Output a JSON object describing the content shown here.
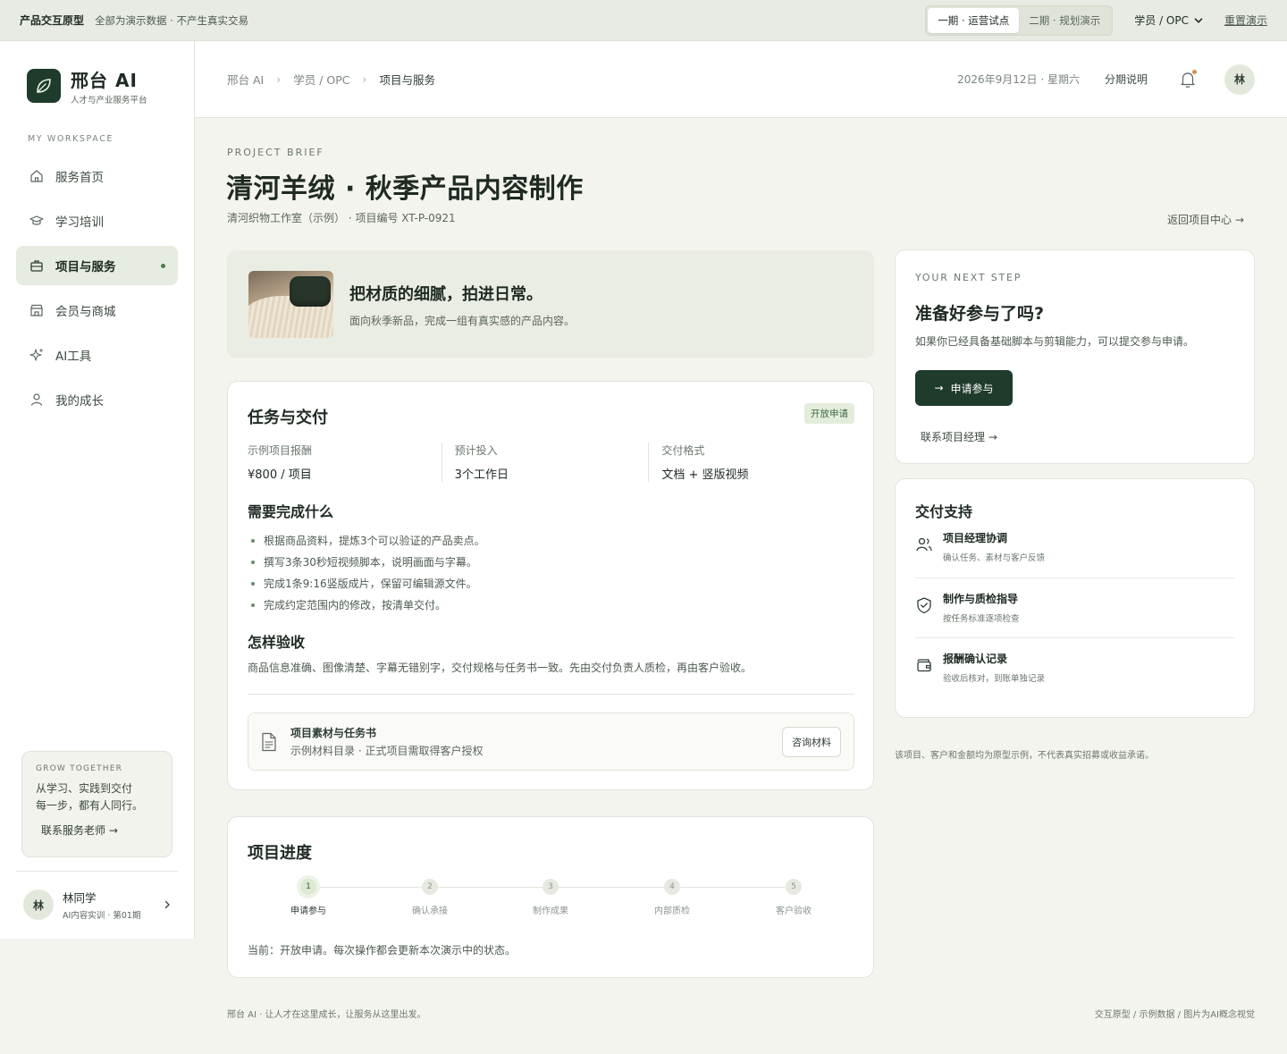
{
  "topbar": {
    "proto_label": "产品交互原型",
    "note": "全部为演示数据 · 不产生真实交易",
    "phases": [
      {
        "label": "一期 · 运营试点",
        "active": true
      },
      {
        "label": "二期 · 规划演示",
        "active": false
      }
    ],
    "role": "学员 / OPC",
    "reset": "重置演示"
  },
  "sidebar": {
    "brand_name": "邢台 AI",
    "brand_sub": "人才与产业服务平台",
    "workspace_label": "MY WORKSPACE",
    "items": [
      {
        "label": "服务首页",
        "icon": "home-icon"
      },
      {
        "label": "学习培训",
        "icon": "graduation-cap-icon"
      },
      {
        "label": "项目与服务",
        "icon": "briefcase-icon",
        "active": true
      },
      {
        "label": "会员与商城",
        "icon": "store-icon"
      },
      {
        "label": "AI工具",
        "icon": "sparkle-icon"
      },
      {
        "label": "我的成长",
        "icon": "user-icon"
      }
    ],
    "grow": {
      "title": "GROW TOGETHER",
      "line1": "从学习、实践到交付",
      "line2": "每一步，都有人同行。",
      "link": "联系服务老师"
    },
    "user": {
      "avatar": "林",
      "name": "林同学",
      "sub": "AI内容实训 · 第01期"
    }
  },
  "header": {
    "breadcrumb": [
      "邢台 AI",
      "学员 / OPC",
      "项目与服务"
    ],
    "date": "2026年9月12日 · 星期六",
    "phase_link": "分期说明",
    "avatar": "林"
  },
  "project": {
    "kicker": "PROJECT BRIEF",
    "title": "清河羊绒 · 秋季产品内容制作",
    "meta": "清河织物工作室（示例） · 项目编号 XT-P-0921",
    "back_link": "返回项目中心"
  },
  "banner": {
    "title": "把材质的细腻，拍进日常。",
    "sub": "面向秋季新品，完成一组有真实感的产品内容。"
  },
  "task": {
    "title": "任务与交付",
    "badge": "开放申请",
    "stats": [
      {
        "label": "示例项目报酬",
        "value": "¥800 / 项目"
      },
      {
        "label": "预计投入",
        "value": "3个工作日"
      },
      {
        "label": "交付格式",
        "value": "文档 + 竖版视频"
      }
    ],
    "need_title": "需要完成什么",
    "needs": [
      "根据商品资料，提炼3个可以验证的产品卖点。",
      "撰写3条30秒短视频脚本，说明画面与字幕。",
      "完成1条9:16竖版成片，保留可编辑源文件。",
      "完成约定范围内的修改，按清单交付。"
    ],
    "acceptance_title": "怎样验收",
    "acceptance_text": "商品信息准确、图像清楚、字幕无错别字，交付规格与任务书一致。先由交付负责人质检，再由客户验收。",
    "file": {
      "title": "项目素材与任务书",
      "sub": "示例材料目录 · 正式项目需取得客户授权",
      "button": "咨询材料"
    }
  },
  "progress": {
    "title": "项目进度",
    "steps": [
      {
        "num": "1",
        "label": "申请参与",
        "active": true
      },
      {
        "num": "2",
        "label": "确认承接",
        "active": false
      },
      {
        "num": "3",
        "label": "制作成果",
        "active": false
      },
      {
        "num": "4",
        "label": "内部质检",
        "active": false
      },
      {
        "num": "5",
        "label": "客户验收",
        "active": false
      }
    ],
    "note": "当前：开放申请。每次操作都会更新本次演示中的状态。"
  },
  "next_step": {
    "kicker": "YOUR NEXT STEP",
    "title": "准备好参与了吗?",
    "desc": "如果你已经具备基础脚本与剪辑能力，可以提交参与申请。",
    "button": "申请参与",
    "contact": "联系项目经理"
  },
  "support": {
    "title": "交付支持",
    "items": [
      {
        "name": "项目经理协调",
        "desc": "确认任务、素材与客户反馈",
        "icon": "users-icon"
      },
      {
        "name": "制作与质检指导",
        "desc": "按任务标准逐项检查",
        "icon": "shield-check-icon"
      },
      {
        "name": "报酬确认记录",
        "desc": "验收后核对，到账单独记录",
        "icon": "wallet-icon"
      }
    ]
  },
  "disclaimer": "该项目、客户和金额均为原型示例，不代表真实招募或收益承诺。",
  "footer": {
    "left": "邢台 AI · 让人才在这里成长，让服务从这里出发。",
    "right": "交互原型 / 示例数据 / 图片为AI概念视觉"
  },
  "colors": {
    "brand_dark": "#1e3b2b",
    "accent_green": "#4a7a52",
    "badge_bg": "#e4eddc",
    "notify_dot": "#c9935a"
  }
}
